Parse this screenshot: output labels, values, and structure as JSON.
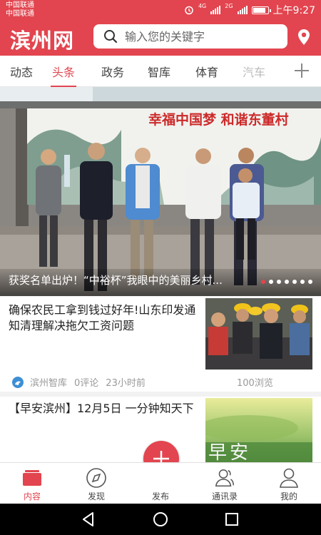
{
  "status_bar": {
    "carrier_line1": "中国联通",
    "carrier_line2": "中国联通",
    "signal1": "4G",
    "signal2": "2G",
    "time": "上午9:27"
  },
  "header": {
    "app_title": "滨州网",
    "search_placeholder": "输入您的关键字",
    "brand_color": "#e2454f"
  },
  "tabs": [
    {
      "label": "动态"
    },
    {
      "label": "头条"
    },
    {
      "label": "政务"
    },
    {
      "label": "智库"
    },
    {
      "label": "体育"
    },
    {
      "label": "汽车"
    }
  ],
  "banner": {
    "mural_slogan": "幸福中国梦 和谐东董村",
    "caption": "获奖名单出炉！“中裕杯”我眼中的美丽乡村...",
    "slide_count": 7,
    "active_slide": 1
  },
  "news": [
    {
      "title": "确保农民工拿到钱过好年!山东印发通知清理解决拖欠工资问题",
      "source": "滨州智库",
      "comments": "0评论",
      "time": "23小时前",
      "views": "100浏览",
      "thumb": "workers-photo"
    },
    {
      "title": "【早安滨州】12月5日 一分钟知天下",
      "thumb_text": "早安",
      "thumb": "morning-photo"
    }
  ],
  "bottom_nav": [
    {
      "label": "内容",
      "icon": "content-icon",
      "active": true
    },
    {
      "label": "发现",
      "icon": "compass-icon"
    },
    {
      "label": "发布",
      "icon": "plus-icon"
    },
    {
      "label": "通讯录",
      "icon": "contacts-icon"
    },
    {
      "label": "我的",
      "icon": "profile-icon"
    }
  ]
}
